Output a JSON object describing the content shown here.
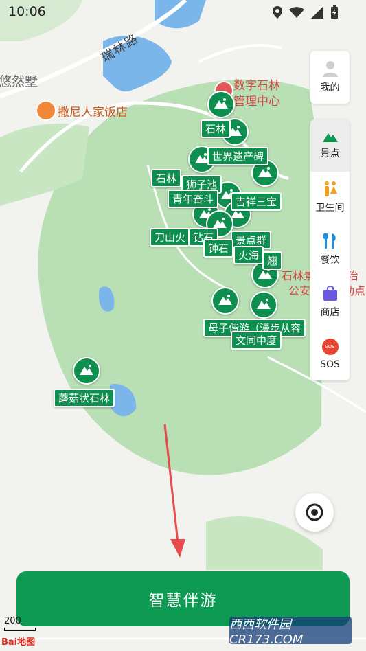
{
  "status_bar": {
    "time": "10:06"
  },
  "map_labels": {
    "villa_partial": "悠然墅",
    "restaurant": "撒尼人家饭店",
    "road": "瑞林路",
    "management_line1": "数字石林",
    "management_line2": "管理中心",
    "shilin_scenic_partial": "石林景区综合治",
    "safety_partial": "公安分局…动点"
  },
  "pois": [
    "石林",
    "世界遗产碑",
    "石林",
    "狮子池",
    "青年奋斗",
    "吉祥三宝",
    "刀山火",
    "钻石",
    "景点群",
    "钟石",
    "火海",
    "翘",
    "母子偕游（漫步从容",
    "文同中度",
    "蘑菇状石林"
  ],
  "side_menu": {
    "profile": "我的",
    "items": [
      {
        "label": "景点",
        "icon": "scenic-icon",
        "active": true
      },
      {
        "label": "卫生间",
        "icon": "toilet-icon",
        "active": false
      },
      {
        "label": "餐饮",
        "icon": "dining-icon",
        "active": false
      },
      {
        "label": "商店",
        "icon": "shop-icon",
        "active": false
      },
      {
        "label": "SOS",
        "icon": "sos-icon",
        "active": false
      }
    ]
  },
  "main_button": "智慧伴游",
  "scale_text": "200",
  "baidu_logo": "Bai地图",
  "watermark": "西西软件园 CR173.COM",
  "colors": {
    "primary": "#0e9a52",
    "pin": "#0e8f4f",
    "water": "#7bb6ea",
    "park": "#b9dfb4"
  }
}
